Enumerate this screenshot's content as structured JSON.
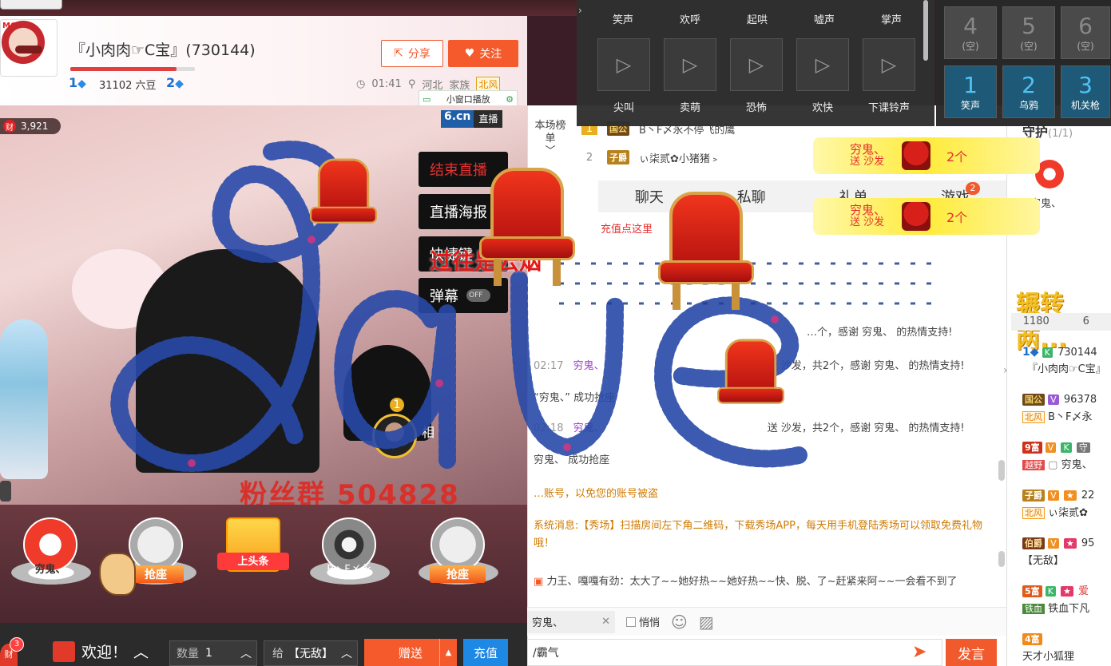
{
  "anchor": {
    "name": "『小肉肉☞C宝』(730144)",
    "level_left": "1",
    "liudou": "31102 六豆",
    "level_right": "2",
    "progress": 0.85,
    "share": "分享",
    "follow": "关注",
    "time": "01:41",
    "location": "河北",
    "family_label": "家族",
    "family_badge": "北风",
    "small_window": "小窗口播放",
    "avatar_text": "MC"
  },
  "video": {
    "fortune_label": "财",
    "fortune_value": "3,921",
    "logo": "6.cn",
    "live": "直播",
    "end_live": "结束直播",
    "poster": "直播海报",
    "hotkey": "快捷键",
    "danmaku": "弹幕",
    "danmaku_state": "OFF",
    "fan_text": "粉丝群 504828",
    "overlay_text": "过往是云烟",
    "guest_rank": "1",
    "guest_name": "相"
  },
  "seats": [
    {
      "label": "穷鬼、"
    },
    {
      "label": "抢座"
    },
    {
      "label": "上头条"
    },
    {
      "label": "B丶F〆永"
    },
    {
      "label": "抢座"
    }
  ],
  "bottom": {
    "fortune": "财",
    "fortune_badge": "3",
    "welcome": "欢迎！",
    "qty_label": "数量",
    "qty_value": "1",
    "to_label": "给",
    "to_value": "【无敌】",
    "send": "赠送",
    "recharge": "充值"
  },
  "rank": {
    "title": "本场榜单",
    "rows": [
      {
        "num": "1",
        "badge": "国公",
        "name": "B丶F〆永不停飞的鹰"
      },
      {
        "num": "2",
        "badge": "子爵",
        "name": "ぃ柒贰✿小猪猪﹥"
      }
    ]
  },
  "tabs": [
    {
      "label": "聊天"
    },
    {
      "label": "私聊"
    },
    {
      "label": "礼单"
    },
    {
      "label": "游戏"
    }
  ],
  "tabs_badge": "2",
  "chat": {
    "recharge_tip": "充值点这里",
    "lines": [
      {
        "time": "",
        "nick": "",
        "text": "…个，感谢 穷鬼、 的热情支持!"
      },
      {
        "time": "02:17",
        "nick": "穷鬼、",
        "text": "送 沙发，共2个，感谢 穷鬼、 的热情支持!"
      },
      {
        "time": "",
        "nick": "",
        "text": "“穷鬼、” 成功抢座"
      },
      {
        "time": "02:18",
        "nick": "穷鬼、",
        "text": "送 沙发，共2个，感谢 穷鬼、 的热情支持!"
      },
      {
        "time": "",
        "nick": "",
        "text": "穷鬼、 成功抢座"
      },
      {
        "time": "",
        "nick": "",
        "text": "…账号，以免您的账号被盗"
      }
    ],
    "system": "系统消息:【秀场】扫描房间左下角二维码，下载秀场APP，每天用手机登陆秀场可以领取免费礼物哦！",
    "last_line": "力王、嘎嘎有劲：太大了~~她好热~~她好热~~快、脱、了~赶紧来阿~~一会看不到了"
  },
  "input": {
    "to_user": "穷鬼、",
    "whisper": "悄悄",
    "message": "/霸气",
    "send": "发言"
  },
  "right": {
    "guard_title": "守护",
    "guard_count": "(1/1)",
    "guard_name": "穷鬼、",
    "banner": "辗转两...",
    "tab_1": "1180",
    "tab_2": "6",
    "users": [
      {
        "text": "730144"
      },
      {
        "text": "『小肉肉☞C宝』"
      },
      {
        "text": "96378"
      },
      {
        "text": "B丶F〆永"
      },
      {
        "text": "守"
      },
      {
        "text": "穷鬼、"
      },
      {
        "text": "22"
      },
      {
        "text": "ぃ柒贰✿"
      },
      {
        "text": "95"
      },
      {
        "text": "【无敌】"
      },
      {
        "text": "爱"
      },
      {
        "text": "铁血下凡"
      },
      {
        "text": "天才小狐狸"
      }
    ]
  },
  "sfx": {
    "top_labels": [
      "笑声",
      "欢呼",
      "起哄",
      "嘘声",
      "掌声"
    ],
    "labels": [
      "尖叫",
      "卖萌",
      "恐怖",
      "欢快",
      "下课铃声"
    ]
  },
  "hotkeys": [
    {
      "n": "4",
      "t": "(空)"
    },
    {
      "n": "5",
      "t": "(空)"
    },
    {
      "n": "6",
      "t": "(空)"
    },
    {
      "n": "1",
      "t": "笑声"
    },
    {
      "n": "2",
      "t": "乌鸦"
    },
    {
      "n": "3",
      "t": "机关枪"
    }
  ],
  "toasts": [
    {
      "who": "穷鬼、",
      "action": "送 沙发",
      "count": "2个"
    },
    {
      "who": "穷鬼、",
      "action": "送 沙发",
      "count": "2个"
    }
  ],
  "colors": {
    "accent": "#f55a2c",
    "recharge": "#1e88e5",
    "nick": "#9b3cc8",
    "system": "#d07a00"
  }
}
